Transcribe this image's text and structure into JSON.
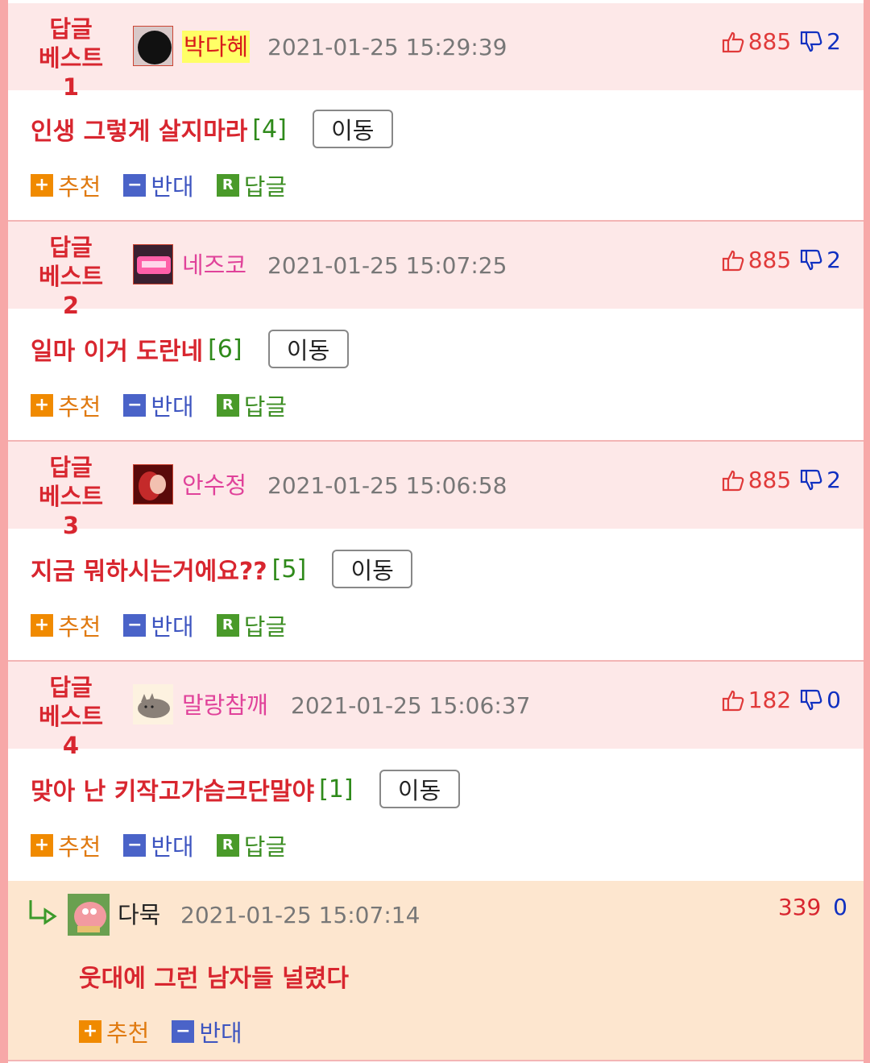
{
  "colors": {
    "header_bg": "#fde8e8",
    "badge_red": "#d8262f",
    "nick_pink": "#e0429a",
    "sub_bg": "#fde6cf"
  },
  "labels": {
    "recommend": "추천",
    "oppose": "반대",
    "reply": "답글",
    "move": "이동"
  },
  "posts": [
    {
      "badge_line1": "답글",
      "badge_line2": "베스트1",
      "nick": "박다혜",
      "date": "2021-01-25 15:29:39",
      "up": "885",
      "down": "2",
      "title": "인생 그렇게 살지마라",
      "count": "[4]",
      "avatar_icon": "dark-avatar-icon"
    },
    {
      "badge_line1": "답글",
      "badge_line2": "베스트2",
      "nick": "네즈코",
      "date": "2021-01-25 15:07:25",
      "up": "885",
      "down": "2",
      "title": "일마 이거 도란네",
      "count": "[6]",
      "avatar_icon": "pink-avatar-icon"
    },
    {
      "badge_line1": "답글",
      "badge_line2": "베스트3",
      "nick": "안수정",
      "date": "2021-01-25 15:06:58",
      "up": "885",
      "down": "2",
      "title": "지금 뭐하시는거에요??",
      "count": "[5]",
      "avatar_icon": "red-avatar-icon"
    },
    {
      "badge_line1": "답글",
      "badge_line2": "베스트4",
      "nick": "말랑참깨",
      "date": "2021-01-25 15:06:37",
      "up": "182",
      "down": "0",
      "title": "맞아 난 키작고가슴크단말야",
      "count": "[1]",
      "avatar_icon": "cat-avatar-icon"
    }
  ],
  "subcomment": {
    "nick": "다묵",
    "date": "2021-01-25 15:07:14",
    "up": "339",
    "down": "0",
    "text": "웃대에 그런 남자들 널렸다",
    "avatar_icon": "cartoon-avatar-icon"
  }
}
